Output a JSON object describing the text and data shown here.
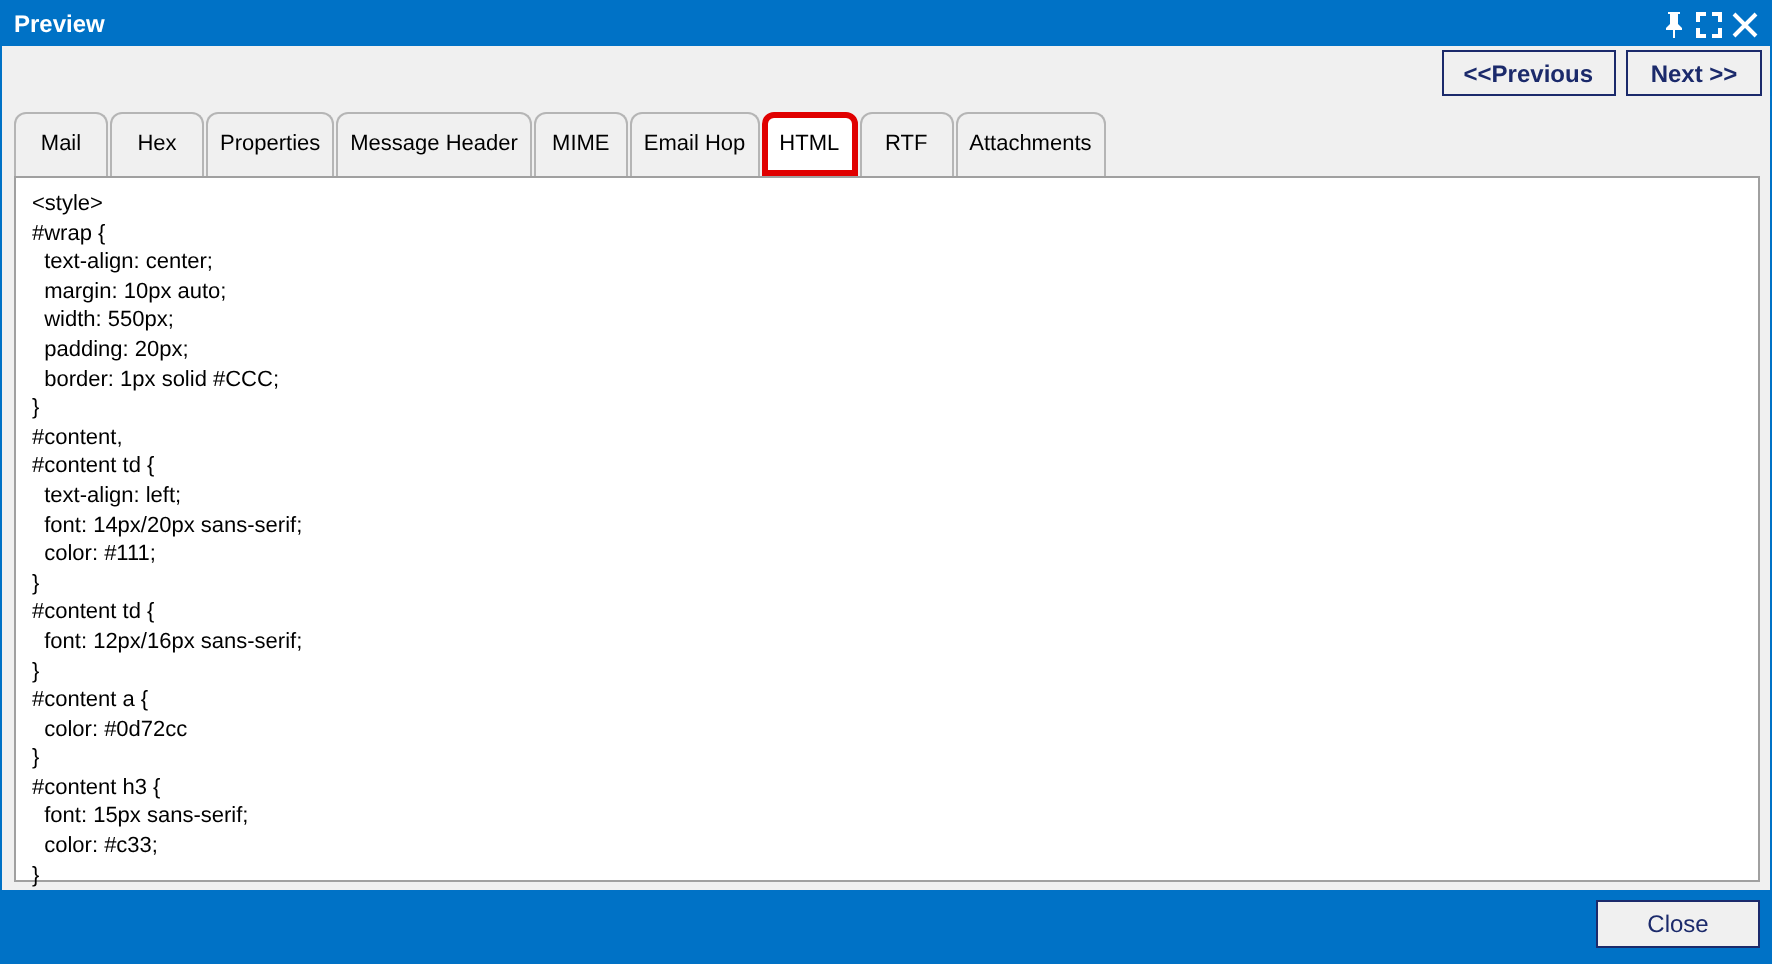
{
  "window": {
    "title": "Preview"
  },
  "nav_buttons": [
    "<<Previous",
    "Next >>"
  ],
  "tabs": [
    {
      "label": "Mail",
      "selected": false,
      "highlighted": false
    },
    {
      "label": "Hex",
      "selected": false,
      "highlighted": false
    },
    {
      "label": "Properties",
      "selected": false,
      "highlighted": false
    },
    {
      "label": "Message Header",
      "selected": false,
      "highlighted": false
    },
    {
      "label": "MIME",
      "selected": false,
      "highlighted": false
    },
    {
      "label": "Email Hop",
      "selected": false,
      "highlighted": false
    },
    {
      "label": "HTML",
      "selected": true,
      "highlighted": true
    },
    {
      "label": "RTF",
      "selected": false,
      "highlighted": false
    },
    {
      "label": "Attachments",
      "selected": false,
      "highlighted": false
    }
  ],
  "html_source": [
    "<style>",
    "#wrap {",
    "  text-align: center;",
    "  margin: 10px auto;",
    "  width: 550px;",
    "  padding: 20px;",
    "  border: 1px solid #CCC;",
    "}",
    "#content,",
    "#content td {",
    "  text-align: left;",
    "  font: 14px/20px sans-serif;",
    "  color: #111;",
    "}",
    "#content td {",
    "  font: 12px/16px sans-serif;",
    "}",
    "#content a {",
    "  color: #0d72cc",
    "}",
    "#content h3 {",
    "  font: 15px sans-serif;",
    "  color: #c33;",
    "}"
  ],
  "footer": {
    "close_button": "Close"
  }
}
